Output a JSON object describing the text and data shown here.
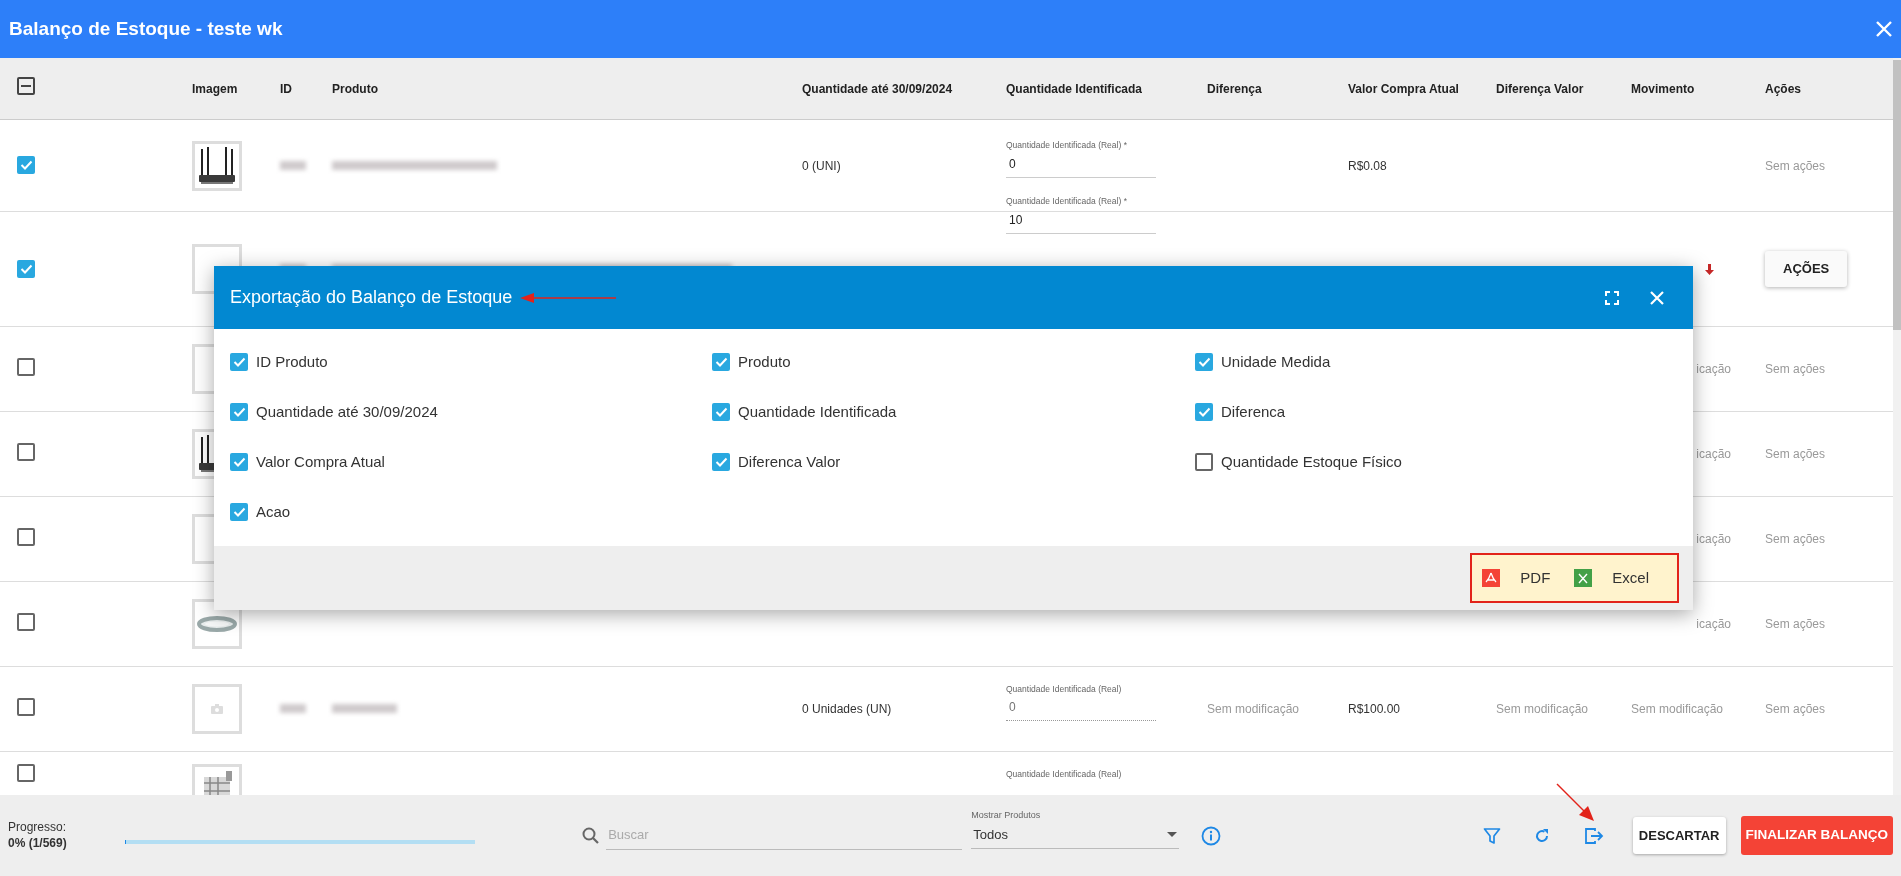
{
  "window": {
    "title": "Balanço de Estoque - teste wk"
  },
  "table": {
    "select_all": {
      "indeterminate": true
    },
    "columns": [
      "Imagem",
      "ID",
      "Produto",
      "Quantidade até 30/09/2024",
      "Quantidade Identificada",
      "Diferença",
      "Valor Compra Atual",
      "Diferença Valor",
      "Movimento",
      "Ações"
    ],
    "rows": [
      {
        "selected": true,
        "redacted": true,
        "quantity": "0 (UNI)",
        "field": {
          "label": "Quantidade Identificada (Real) *",
          "value": "0",
          "disabled": false
        },
        "purchase_value": "R$0.08",
        "action": {
          "kind": "text",
          "label": "Sem ações"
        }
      },
      {
        "selected": true,
        "image": {
          "kind": "blank"
        },
        "redacted": true,
        "field": {
          "label": "Quantidade Identificada (Real) *",
          "value": "10",
          "disabled": false
        },
        "movement_arrow": true,
        "action": {
          "kind": "button",
          "label": "AÇÕES"
        }
      },
      {
        "selected": false,
        "image": {
          "kind": "blank"
        },
        "redacted": false,
        "movement": "icação",
        "action": {
          "kind": "text",
          "label": "Sem ações"
        }
      },
      {
        "selected": false,
        "redacted": false,
        "movement": "icação",
        "action": {
          "kind": "text",
          "label": "Sem ações"
        }
      },
      {
        "selected": false,
        "image": {
          "kind": "blank"
        },
        "redacted": false,
        "movement": "icação",
        "action": {
          "kind": "text",
          "label": "Sem ações"
        }
      },
      {
        "selected": false,
        "redacted": false,
        "movement": "icação",
        "action": {
          "kind": "text",
          "label": "Sem ações"
        }
      },
      {
        "selected": false,
        "image": {
          "kind": "placeholder"
        },
        "redacted": true,
        "quantity": "0 Unidades (UN)",
        "field": {
          "label": "Quantidade Identificada (Real)",
          "placeholder": "0",
          "disabled": true
        },
        "difference": "Sem modificação",
        "purchase_value": "R$100.00",
        "value_difference": "Sem modificação",
        "movement": "Sem modificação",
        "action": {
          "kind": "text",
          "label": "Sem ações"
        }
      },
      {
        "selected": false,
        "redacted": false,
        "field": {
          "label": "Quantidade Identificada (Real)",
          "disabled": true
        }
      }
    ]
  },
  "modal": {
    "title": "Exportação do Balanço de Estoque",
    "title_marked": true,
    "options": [
      {
        "label": "ID Produto",
        "checked": true
      },
      {
        "label": "Produto",
        "checked": true
      },
      {
        "label": "Unidade Medida",
        "checked": true
      },
      {
        "label": "Quantidade até 30/09/2024",
        "checked": true
      },
      {
        "label": "Quantidade Identificada",
        "checked": true
      },
      {
        "label": "Diferenca",
        "checked": true
      },
      {
        "label": "Valor Compra Atual",
        "checked": true
      },
      {
        "label": "Diferenca Valor",
        "checked": true
      },
      {
        "label": "Quantidade Estoque Físico",
        "checked": false
      },
      {
        "label": "Acao",
        "checked": true
      }
    ],
    "exports_highlighted": true,
    "exports": [
      {
        "kind": "pdf",
        "label": "PDF"
      },
      {
        "kind": "excel",
        "label": "Excel"
      }
    ]
  },
  "footer": {
    "progress": {
      "label": "Progresso:",
      "value": "0% (1/569)",
      "level": 0.0018
    },
    "search": {
      "placeholder": "Buscar"
    },
    "filter": {
      "label": "Mostrar Produtos",
      "value": "Todos"
    },
    "export_marked": true,
    "buttons": [
      {
        "kind": "secondary",
        "label": "DESCARTAR"
      },
      {
        "kind": "danger",
        "label": "FINALIZAR BALANÇO"
      }
    ]
  }
}
